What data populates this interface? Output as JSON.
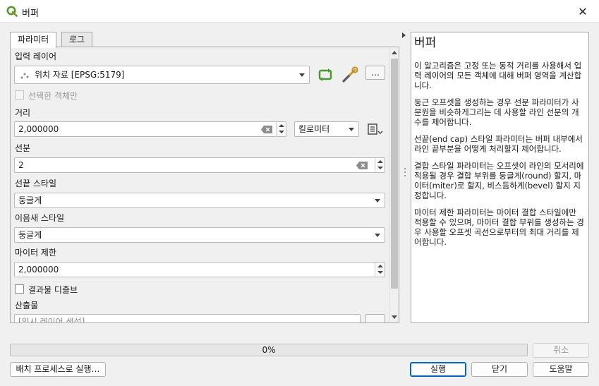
{
  "window": {
    "title": "버퍼"
  },
  "tabs": [
    {
      "label": "파라미터",
      "active": true
    },
    {
      "label": "로그",
      "active": false
    }
  ],
  "params": {
    "input_layer": {
      "label": "입력 레이어",
      "value": "위치 자료 [EPSG:5179]"
    },
    "selected_only": {
      "label": "선택한 객체만",
      "checked": false,
      "enabled": false
    },
    "distance": {
      "label": "거리",
      "value": "2,000000",
      "unit": "킬로미터"
    },
    "segments": {
      "label": "선분",
      "value": "2"
    },
    "end_cap": {
      "label": "선끝 스타일",
      "value": "둥글게"
    },
    "join_style": {
      "label": "이음새 스타일",
      "value": "둥글게"
    },
    "miter_limit": {
      "label": "마이터 제한",
      "value": "2,000000"
    },
    "dissolve": {
      "label": "결과물 디졸브",
      "checked": false
    },
    "output": {
      "label": "산출물",
      "placeholder": "[임시 레이어 생성]"
    },
    "more_label": "…"
  },
  "help": {
    "title": "버퍼",
    "paragraphs": [
      "이 알고리즘은 고정 또는 동적 거리를 사용해서 입력 레이어의 모든 객체에 대해 버퍼 영역을 계산합니다.",
      "둥근 오프셋을 생성하는 경우 선분 파라미터가 사분원을 비슷하게그리는 데 사용할 라인 선분의 개수를 제어합니다.",
      "선끝(end cap) 스타일 파라미터는 버퍼 내부에서 라인 끝부분을 어떻게 처리할지 제어합니다.",
      "결합 스타일 파라미터는 오프셋이 라인의 모서리에 적용될 경우 결합 부위를 둥글게(round) 할지, 마이터(miter)로 할지, 비스듬하게(bevel) 할지 지정합니다.",
      "마이터 제한 파라미터는 마이터 결합 스타일에만 적용할 수 있으며, 마이터 결합 부위를 생성하는 경우 사용할 오프셋 곡선으로부터의 최대 거리를 제어합니다."
    ]
  },
  "progress": {
    "percent": 0,
    "label": "0%"
  },
  "buttons": {
    "cancel": "취소",
    "batch": "배치 프로세스로 실행…",
    "run": "실행",
    "close": "닫기",
    "help": "도움말"
  },
  "colors": {
    "accent": "#0067c0",
    "qgis_green": "#589632"
  }
}
